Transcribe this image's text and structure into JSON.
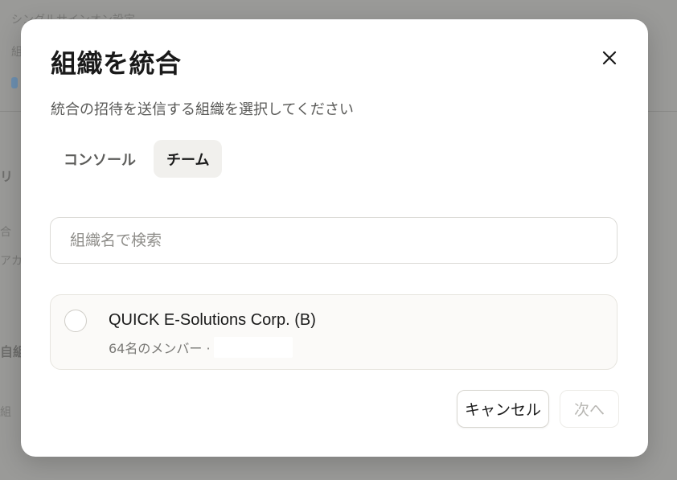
{
  "background": {
    "texts": [
      "シングルサインオン設定",
      "組",
      "リ",
      "合",
      "アカ",
      "自組",
      "組"
    ]
  },
  "modal": {
    "title": "組織を統合",
    "subtitle": "統合の招待を送信する組織を選択してください",
    "close_icon": "close-icon",
    "tabs": [
      {
        "label": "コンソール",
        "active": false
      },
      {
        "label": "チーム",
        "active": true
      }
    ],
    "search": {
      "placeholder": "組織名で検索",
      "value": ""
    },
    "organizations": [
      {
        "name": "QUICK E-Solutions Corp. (B)",
        "members": "64名のメンバー ·",
        "selected": false
      }
    ],
    "buttons": {
      "cancel": "キャンセル",
      "next": "次へ"
    }
  },
  "colors": {
    "overlay": "#9a9a98",
    "modal_bg": "#ffffff",
    "active_tab_bg": "#f1f0ed",
    "disabled_text": "#b8b7b3"
  }
}
